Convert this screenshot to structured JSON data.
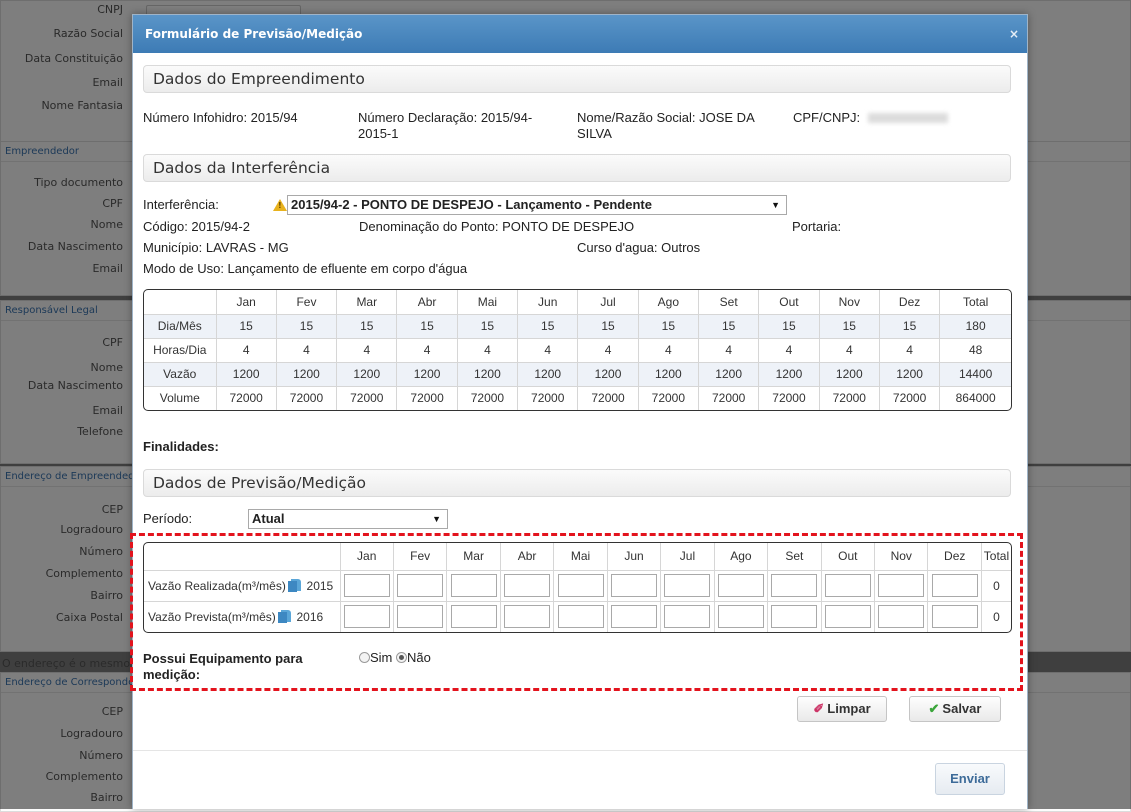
{
  "background": {
    "labels_top": [
      "CNPJ",
      "Razão Social",
      "Data Constituição",
      "Email",
      "Nome Fantasia"
    ],
    "empreendedor": {
      "title": "Empreendedor",
      "labels": [
        "Tipo documento",
        "CPF",
        "Nome",
        "Data Nascimento",
        "Email"
      ]
    },
    "responsavel": {
      "title": "Responsável Legal",
      "labels": [
        "CPF",
        "Nome",
        "Data Nascimento",
        "Email",
        "Telefone"
      ]
    },
    "endereco_emp": {
      "title": "Endereço de Empreendedor",
      "labels": [
        "CEP",
        "Logradouro",
        "Número",
        "Complemento",
        "Bairro",
        "Caixa Postal"
      ]
    },
    "note": "O endereço é o mesmo",
    "endereco_corr": {
      "title": "Endereço de Correspondência",
      "labels": [
        "CEP",
        "Logradouro",
        "Número",
        "Complemento",
        "Bairro"
      ]
    }
  },
  "modal": {
    "title": "Formulário de Previsão/Medição",
    "close": "×",
    "sections": {
      "empreendimento": "Dados do Empreendimento",
      "interferencia": "Dados da Interferência",
      "previsao": "Dados de Previsão/Medição"
    },
    "empreendimento": {
      "infohidro": "Número Infohidro: 2015/94",
      "declaracao_line1": "Número Declaração: 2015/94-",
      "declaracao_line2": "2015-1",
      "nome_line1": "Nome/Razão Social: JOSE DA",
      "nome_line2": "SILVA",
      "cpf_label": "CPF/CNPJ:"
    },
    "interferencia": {
      "label": "Interferência:",
      "selected": "2015/94-2 - PONTO DE DESPEJO - Lançamento - Pendente",
      "codigo": "Código: 2015/94-2",
      "denominacao": "Denominação do Ponto: PONTO DE DESPEJO",
      "portaria": "Portaria:",
      "municipio": "Município: LAVRAS - MG",
      "curso": "Curso d'agua: Outros",
      "modo": "Modo de Uso: Lançamento de efluente em corpo d'água",
      "finalidades": "Finalidades:"
    },
    "months": [
      "Jan",
      "Fev",
      "Mar",
      "Abr",
      "Mai",
      "Jun",
      "Jul",
      "Ago",
      "Set",
      "Out",
      "Nov",
      "Dez",
      "Total"
    ],
    "usage_rows": [
      {
        "label": "Dia/Mês",
        "values": [
          "15",
          "15",
          "15",
          "15",
          "15",
          "15",
          "15",
          "15",
          "15",
          "15",
          "15",
          "15",
          "180"
        ]
      },
      {
        "label": "Horas/Dia",
        "values": [
          "4",
          "4",
          "4",
          "4",
          "4",
          "4",
          "4",
          "4",
          "4",
          "4",
          "4",
          "4",
          "48"
        ]
      },
      {
        "label": "Vazão",
        "values": [
          "1200",
          "1200",
          "1200",
          "1200",
          "1200",
          "1200",
          "1200",
          "1200",
          "1200",
          "1200",
          "1200",
          "1200",
          "14400"
        ]
      },
      {
        "label": "Volume",
        "values": [
          "72000",
          "72000",
          "72000",
          "72000",
          "72000",
          "72000",
          "72000",
          "72000",
          "72000",
          "72000",
          "72000",
          "72000",
          "864000"
        ]
      }
    ],
    "periodo": {
      "label": "Período:",
      "selected": "Atual"
    },
    "input_rows": [
      {
        "label": "Vazão Realizada(m³/mês)",
        "year": "2015",
        "total": "0"
      },
      {
        "label": "Vazão Prevista(m³/mês)",
        "year": "2016",
        "total": "0"
      }
    ],
    "equipamento": {
      "label_line1": "Possui Equipamento para",
      "label_line2": "medição:",
      "options": [
        "Sim",
        "Não"
      ],
      "selected": "Não"
    },
    "buttons": {
      "limpar": "Limpar",
      "salvar": "Salvar",
      "enviar": "Enviar"
    },
    "colors": {
      "header": "#3d7bb5",
      "highlight": "#e3131d",
      "warning": "#e8b21d",
      "salvar_check": "#3aa53a"
    }
  }
}
